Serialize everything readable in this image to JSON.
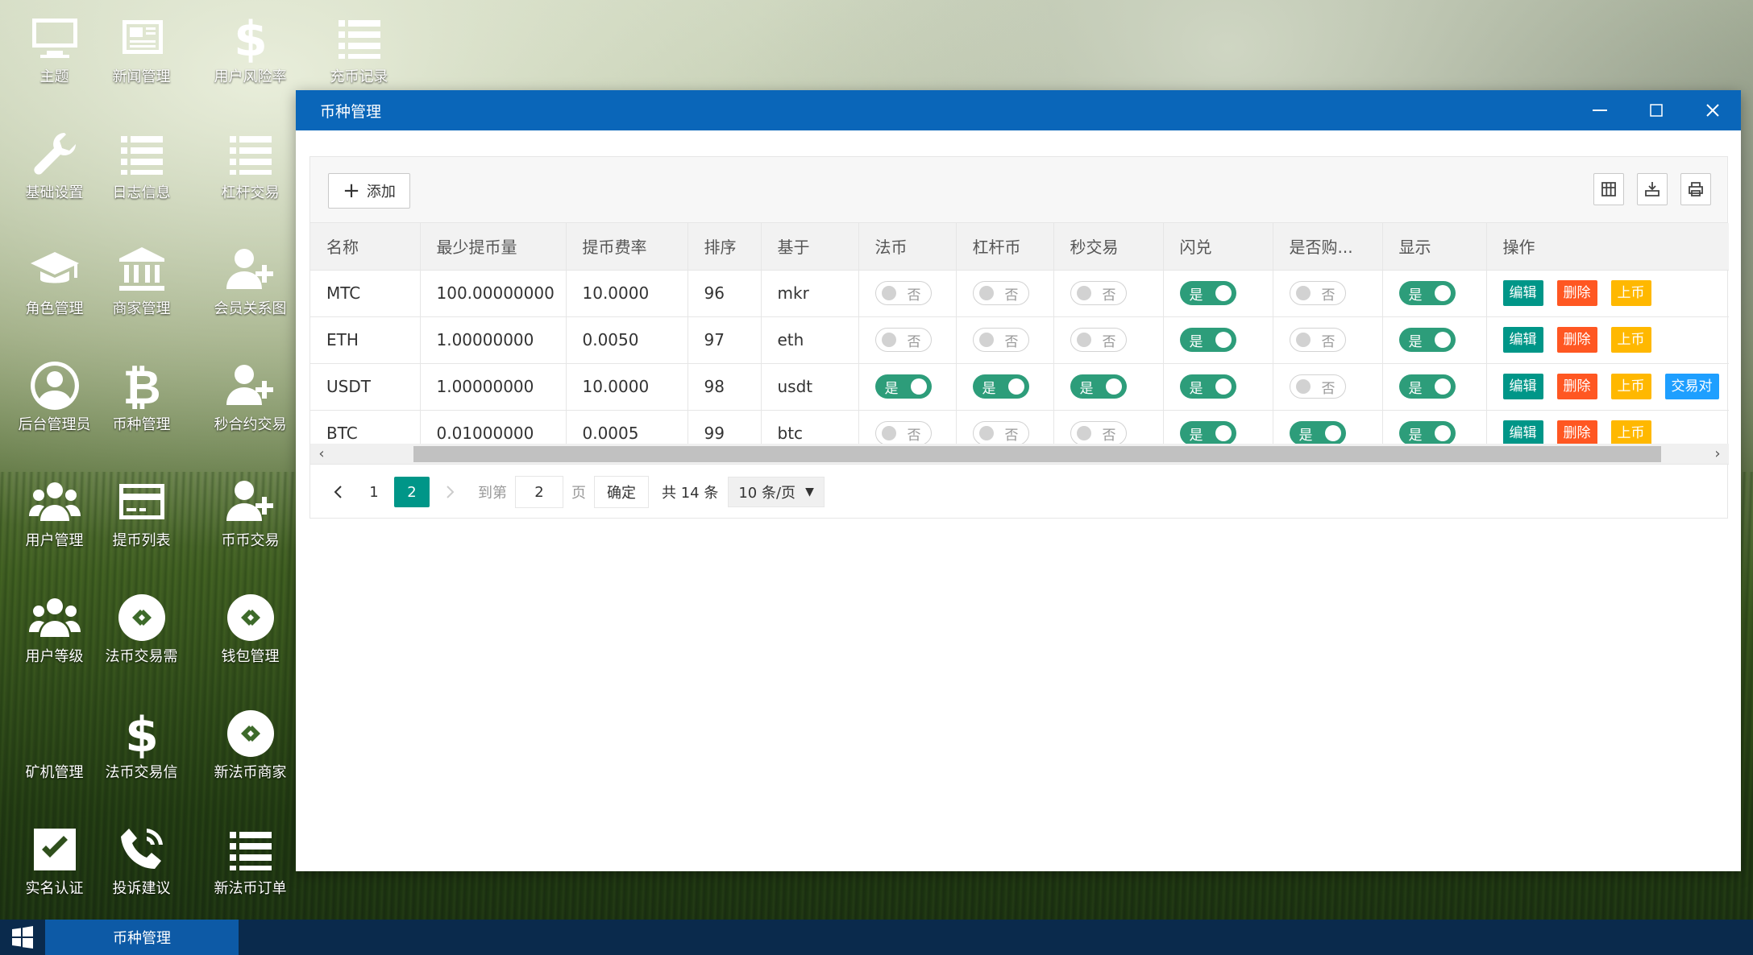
{
  "desktop": {
    "icons": [
      {
        "label": "主题",
        "icon": "monitor-icon"
      },
      {
        "label": "新闻管理",
        "icon": "newspaper-icon"
      },
      {
        "label": "用户风险率",
        "icon": "dollar-icon"
      },
      {
        "label": "充币记录",
        "icon": "list-icon"
      },
      {
        "label": "基础设置",
        "icon": "wrench-icon"
      },
      {
        "label": "日志信息",
        "icon": "list-icon"
      },
      {
        "label": "杠杆交易",
        "icon": "list-icon"
      },
      {
        "label": "角色管理",
        "icon": "graduation-cap-icon"
      },
      {
        "label": "商家管理",
        "icon": "bank-icon"
      },
      {
        "label": "会员关系图",
        "icon": "user-plus-icon"
      },
      {
        "label": "后台管理员",
        "icon": "user-circle-icon"
      },
      {
        "label": "币种管理",
        "icon": "bitcoin-icon"
      },
      {
        "label": "秒合约交易",
        "icon": "user-plus-icon"
      },
      {
        "label": "用户管理",
        "icon": "users-icon"
      },
      {
        "label": "提币列表",
        "icon": "credit-card-icon"
      },
      {
        "label": "币币交易",
        "icon": "user-plus-icon"
      },
      {
        "label": "用户等级",
        "icon": "users-icon"
      },
      {
        "label": "法币交易需",
        "icon": "link-circle-icon"
      },
      {
        "label": "钱包管理",
        "icon": "link-circle-icon"
      },
      {
        "label": "矿机管理",
        "icon": "none"
      },
      {
        "label": "法币交易信",
        "icon": "dollar-icon"
      },
      {
        "label": "新法币商家",
        "icon": "link-circle-icon"
      },
      {
        "label": "实名认证",
        "icon": "check-square-icon"
      },
      {
        "label": "投诉建议",
        "icon": "phone-icon"
      },
      {
        "label": "新法币订单",
        "icon": "list-icon"
      }
    ]
  },
  "window": {
    "title": "币种管理",
    "add_label": "添加",
    "toggle_on": "是",
    "toggle_off": "否",
    "ops": {
      "edit": "编辑",
      "delete": "删除",
      "list": "上币",
      "pair": "交易对"
    },
    "columns": [
      "名称",
      "最少提币量",
      "提币费率",
      "排序",
      "基于",
      "法币",
      "杠杆币",
      "秒交易",
      "闪兑",
      "是否购...",
      "显示",
      "操作"
    ],
    "rows": [
      {
        "name": "MTC",
        "min": "100.00000000",
        "fee": "10.0000",
        "sort": "96",
        "base": "mkr",
        "fiat": false,
        "lever": false,
        "second": false,
        "flash": true,
        "buy": false,
        "show": true,
        "pair": false
      },
      {
        "name": "ETH",
        "min": "1.00000000",
        "fee": "0.0050",
        "sort": "97",
        "base": "eth",
        "fiat": false,
        "lever": false,
        "second": false,
        "flash": true,
        "buy": false,
        "show": true,
        "pair": false
      },
      {
        "name": "USDT",
        "min": "1.00000000",
        "fee": "10.0000",
        "sort": "98",
        "base": "usdt",
        "fiat": true,
        "lever": true,
        "second": true,
        "flash": true,
        "buy": false,
        "show": true,
        "pair": true
      },
      {
        "name": "BTC",
        "min": "0.01000000",
        "fee": "0.0005",
        "sort": "99",
        "base": "btc",
        "fiat": false,
        "lever": false,
        "second": false,
        "flash": true,
        "buy": true,
        "show": true,
        "pair": false
      }
    ],
    "pager": {
      "page1": "1",
      "page2": "2",
      "goto_label": "到第",
      "goto_value": "2",
      "page_unit": "页",
      "confirm": "确定",
      "total": "共 14 条",
      "page_size": "10 条/页"
    }
  },
  "taskbar": {
    "task_label": "币种管理"
  },
  "colors": {
    "titlebar": "#0a66b9",
    "toggle_on": "#2d9d7a",
    "edit": "#009688",
    "delete": "#ff5722",
    "list": "#ffb800",
    "pair": "#1e9fff"
  }
}
